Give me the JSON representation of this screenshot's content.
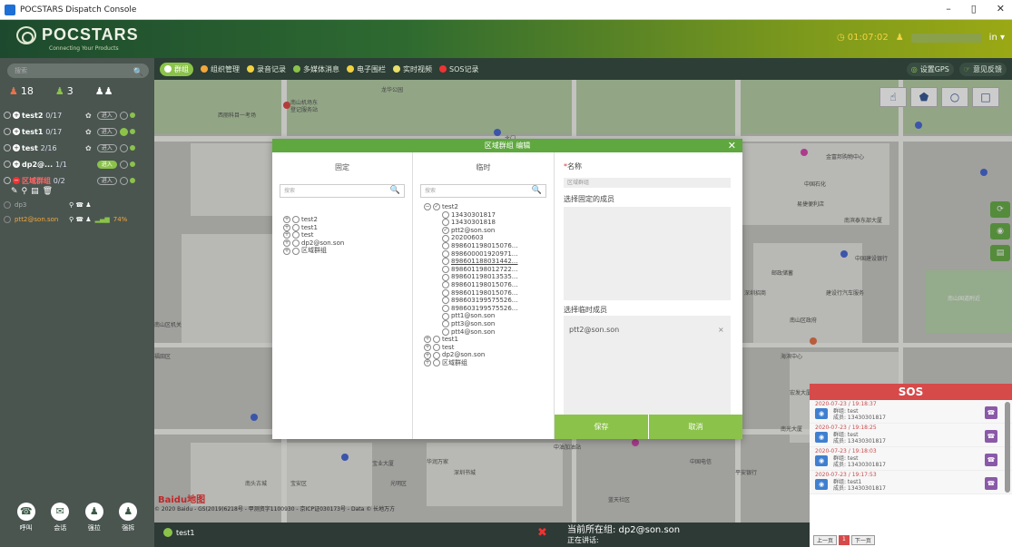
{
  "window": {
    "title": "POCSTARS Dispatch Console",
    "min": "–",
    "restore": "▯",
    "close": "✕"
  },
  "header": {
    "logo": "POCSTARS",
    "tagline": "Connecting Your Products",
    "clock": "01:07:02",
    "user_suffix": "in ▾"
  },
  "toolbar": {
    "items": [
      {
        "label": "群组",
        "active": true
      },
      {
        "label": "组织管理",
        "active": false
      },
      {
        "label": "录音记录",
        "active": false
      },
      {
        "label": "多媒体消息",
        "active": false
      },
      {
        "label": "电子围栏",
        "active": false
      },
      {
        "label": "实时视频",
        "active": false
      },
      {
        "label": "SOS记录",
        "active": false
      }
    ],
    "gps": "设置GPS",
    "feedback": "意见反馈"
  },
  "sidebar": {
    "search_placeholder": "搜索",
    "stats": {
      "online": "18",
      "offline": "3",
      "group_icon": "group-icon"
    },
    "groups": [
      {
        "name": "test2",
        "count": "0/17",
        "enter": "进入",
        "enter_active": false
      },
      {
        "name": "test1",
        "count": "0/17",
        "enter": "进入",
        "enter_active": false
      },
      {
        "name": "test",
        "count": "2/16",
        "enter": "进入",
        "enter_active": false
      },
      {
        "name": "dp2@...",
        "count": "1/1",
        "enter": "进入",
        "enter_active": true
      },
      {
        "name": "区域群组",
        "count": "0/2",
        "enter": "进入",
        "enter_active": false
      }
    ],
    "members": [
      {
        "name": "dp3"
      },
      {
        "name": "ptt2@son.son",
        "battery": "74%"
      }
    ],
    "actions": [
      {
        "label": "呼叫"
      },
      {
        "label": "会话"
      },
      {
        "label": "强拉"
      },
      {
        "label": "强拆"
      }
    ]
  },
  "modal": {
    "title": "区域群组 编辑",
    "fixed_header": "固定",
    "temp_header": "临时",
    "search_placeholder": "搜索",
    "fixed_tree": [
      "test2",
      "test1",
      "test",
      "dp2@son.son",
      "区域群组"
    ],
    "temp_root": "test2",
    "temp_children": [
      "13430301817",
      "13430301818",
      "ptt2@son.son",
      "20200603",
      "898601198015076...",
      "898600001920971...",
      "898601188031442...",
      "898601198012722...",
      "898601198013535...",
      "898601198015076...",
      "898601198015076...",
      "898603199575526...",
      "898603199575526...",
      "ptt1@son.son",
      "ptt3@son.son",
      "ptt4@son.son"
    ],
    "temp_tree_rest": [
      "test1",
      "test",
      "dp2@son.son",
      "区域群组"
    ],
    "name_label": "名称",
    "name_value": "区域群组",
    "fixed_members_label": "选择固定的成员",
    "temp_members_label": "选择临时成员",
    "temp_member_tag": "ptt2@son.son",
    "save": "保存",
    "cancel": "取消"
  },
  "map": {
    "labels": [
      "南山机场东",
      "登记服务站",
      "西丽科目一考场",
      "北门",
      "龙华公园",
      "中国石化",
      "金富邦购物中心",
      "易捷便利店",
      "南滨泰东部大厦",
      "深圳招商",
      "南山区机关",
      "中国建设银行",
      "邮政储蓄",
      "南山国道附近",
      "南山区政府",
      "海滨中心",
      "宏发大厦",
      "福田区",
      "南光大厦",
      "南头古城",
      "蓝天社区",
      "建设行汽车服务",
      "中国电信",
      "华润万家",
      "平安银行",
      "中油加油站",
      "深圳书城",
      "宝安区",
      "光明区",
      "宝业大厦"
    ],
    "copyright": "© 2020 Baidu - GS(2019)6218号 - 甲测资字1100930 - 京ICP证030173号 - Data © 长地万方",
    "baidu": "Baidu地图"
  },
  "bottom": {
    "chip": "test1",
    "current_group": "当前所在组: dp2@son.son",
    "speaking": "正在讲话:"
  },
  "sos": {
    "title": "SOS",
    "items": [
      {
        "time": "2020-07-23 / 19:18:37",
        "group": "群组: test",
        "member": "成员: 13430301817"
      },
      {
        "time": "2020-07-23 / 19:18:25",
        "group": "群组: test",
        "member": "成员: 13430301817"
      },
      {
        "time": "2020-07-23 / 19:18:03",
        "group": "群组: test",
        "member": "成员: 13430301817"
      },
      {
        "time": "2020-07-23 / 19:17:53",
        "group": "群组: test1",
        "member": "成员: 13430301817"
      }
    ],
    "prev": "上一页",
    "page": "1",
    "next": "下一页"
  }
}
